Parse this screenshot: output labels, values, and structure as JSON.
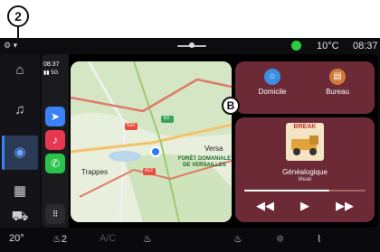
{
  "callouts": {
    "two": "2",
    "b": "B"
  },
  "statusbar": {
    "temperature": "10°C",
    "time": "08:37"
  },
  "carplay": {
    "dock": {
      "time": "08:37",
      "network": "5G"
    },
    "map": {
      "place_versailles": "Versa",
      "place_trappes": "Trappes",
      "forest": "FORÊT DOMANIALE DE VERSAILLES",
      "road_a12": "A12",
      "road_e5": "E5",
      "road_n10": "N10"
    },
    "destinations": [
      {
        "label": "Domicile",
        "icon": "home-icon",
        "color": "#3b8ee0"
      },
      {
        "label": "Bureau",
        "icon": "briefcase-icon",
        "color": "#d07a3a"
      }
    ],
    "media": {
      "album_title": "BREAK",
      "song": "Généalogique",
      "artist": "Meak",
      "progress": 0.7
    }
  },
  "bottombar": {
    "temp_left": "20°",
    "seat_left": "2",
    "ac": "A/C"
  },
  "colors": {
    "widget_bg": "#6b2a36",
    "accent": "#3b82f6"
  }
}
